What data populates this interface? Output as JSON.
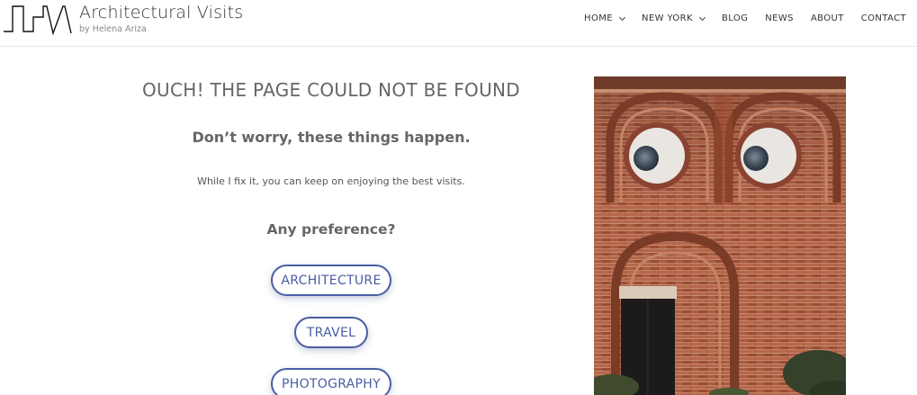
{
  "header": {
    "site_title": "Architectural Visits",
    "site_subtitle": "by Helena Ariza",
    "nav": [
      {
        "label": "HOME",
        "dropdown": true
      },
      {
        "label": "NEW YORK",
        "dropdown": true
      },
      {
        "label": "BLOG",
        "dropdown": false
      },
      {
        "label": "NEWS",
        "dropdown": false
      },
      {
        "label": "ABOUT",
        "dropdown": false
      },
      {
        "label": "CONTACT",
        "dropdown": false
      }
    ]
  },
  "main": {
    "heading": "OUCH! THE PAGE COULD NOT BE FOUND",
    "subheading": "Don’t worry, these things happen.",
    "text": "While I fix it, you can keep on enjoying the best visits.",
    "question": "Any preference?",
    "buttons": [
      "ARCHITECTURE",
      "TRAVEL",
      "PHOTOGRAPHY"
    ]
  },
  "colors": {
    "accent": "#4a5ea3",
    "brick": "#a5533a",
    "text": "#666666"
  }
}
